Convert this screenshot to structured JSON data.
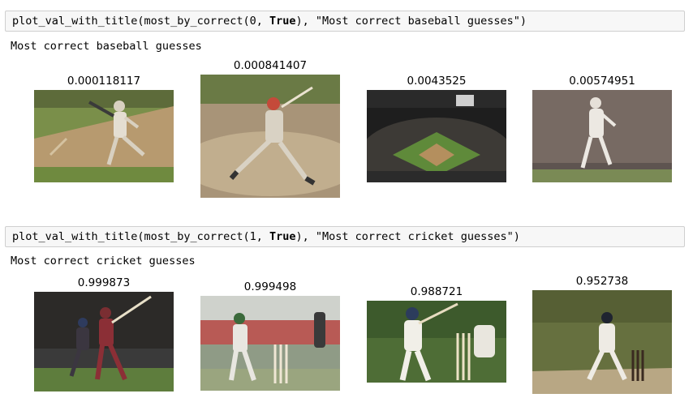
{
  "cells": [
    {
      "code_prefix": "plot_val_with_title(most_by_correct(0, ",
      "code_kw": "True",
      "code_suffix": "), \"Most correct baseball guesses\")",
      "title": "Most correct baseball guesses",
      "values": [
        "0.000118117",
        "0.000841407",
        "0.0043525",
        "0.00574951"
      ]
    },
    {
      "code_prefix": "plot_val_with_title(most_by_correct(1, ",
      "code_kw": "True",
      "code_suffix": "), \"Most correct cricket guesses\")",
      "title": "Most correct cricket guesses",
      "values": [
        "0.999873",
        "0.999498",
        "0.988721",
        "0.952738"
      ]
    }
  ],
  "images": [
    {
      "name": "baseball-batter-swing-photo"
    },
    {
      "name": "baseball-batter-follow-through-photo"
    },
    {
      "name": "baseball-stadium-night-photo"
    },
    {
      "name": "baseball-pitcher-photo"
    },
    {
      "name": "cricket-batsman-stadium-photo"
    },
    {
      "name": "cricket-batsman-stumps-photo"
    },
    {
      "name": "cricket-junior-batsman-photo"
    },
    {
      "name": "cricket-batsman-pitch-photo"
    }
  ]
}
